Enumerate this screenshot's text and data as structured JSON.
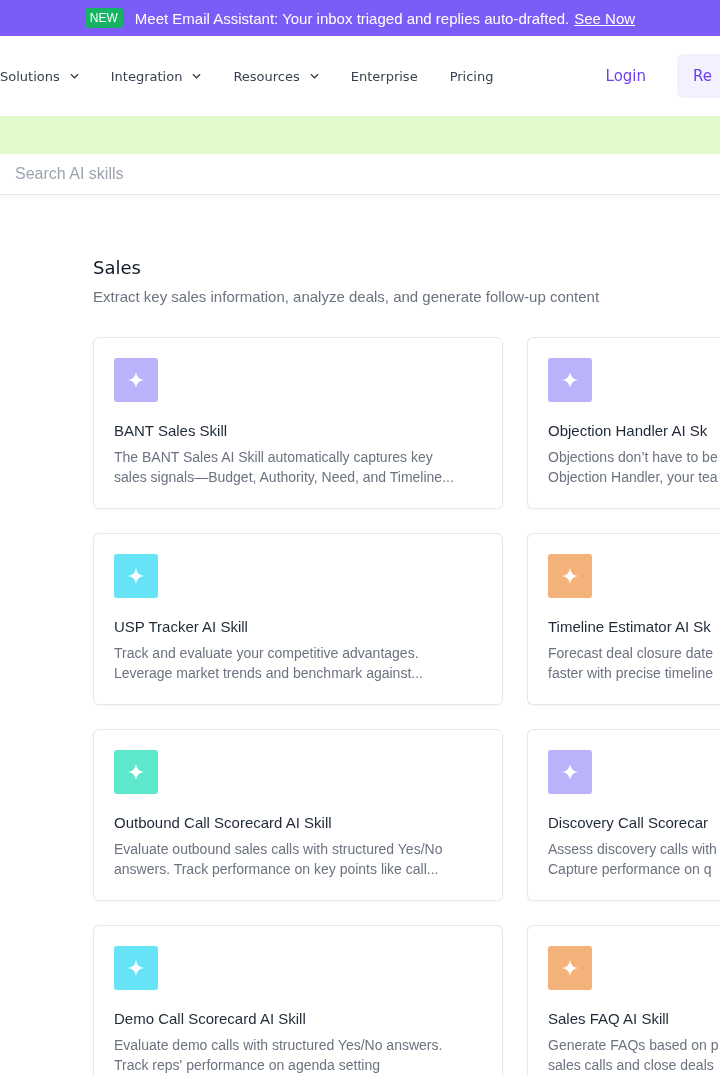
{
  "announcement": {
    "badge": "NEW",
    "text": "Meet Email Assistant: Your inbox triaged and replies auto-drafted.",
    "link": "See Now"
  },
  "nav": {
    "items": [
      {
        "label": "Solutions",
        "dropdown": true
      },
      {
        "label": "Integration",
        "dropdown": true
      },
      {
        "label": "Resources",
        "dropdown": true
      },
      {
        "label": "Enterprise",
        "dropdown": false
      },
      {
        "label": "Pricing",
        "dropdown": false
      }
    ],
    "login": "Login",
    "cta": "Re"
  },
  "search": {
    "placeholder": "Search AI skills"
  },
  "section": {
    "title": "Sales",
    "subtitle": "Extract key sales information, analyze deals, and generate follow-up content"
  },
  "cards": [
    {
      "title": "BANT Sales Skill",
      "description": [
        "The BANT Sales AI Skill automatically captures key",
        "sales signals—Budget, Authority, Need, and Timeline..."
      ],
      "color": "#bab3fb"
    },
    {
      "title": "Objection Handler AI Sk",
      "description": [
        "Objections don’t have to be",
        "Objection Handler, your tea"
      ],
      "color": "#bab3fb"
    },
    {
      "title": "USP Tracker AI Skill",
      "description": [
        "Track and evaluate your competitive advantages.",
        "Leverage market trends and benchmark against..."
      ],
      "color": "#67e3f8"
    },
    {
      "title": "Timeline Estimator AI Sk",
      "description": [
        "Forecast deal closure date",
        "faster with precise timeline"
      ],
      "color": "#f5b17a"
    },
    {
      "title": "Outbound Call Scorecard AI Skill",
      "description": [
        "Evaluate outbound sales calls with structured Yes/No",
        "answers. Track performance on key points like call..."
      ],
      "color": "#5ee8cb"
    },
    {
      "title": "Discovery Call Scorecar",
      "description": [
        "Assess discovery calls with",
        "Capture performance on q"
      ],
      "color": "#bab3fb"
    },
    {
      "title": "Demo Call Scorecard AI Skill",
      "description": [
        "Evaluate demo calls with structured Yes/No answers.",
        "Track reps' performance on agenda setting"
      ],
      "color": "#67e3f8"
    },
    {
      "title": "Sales FAQ AI Skill",
      "description": [
        "Generate FAQs based on p",
        "sales calls and close deals"
      ],
      "color": "#f5b17a"
    }
  ]
}
